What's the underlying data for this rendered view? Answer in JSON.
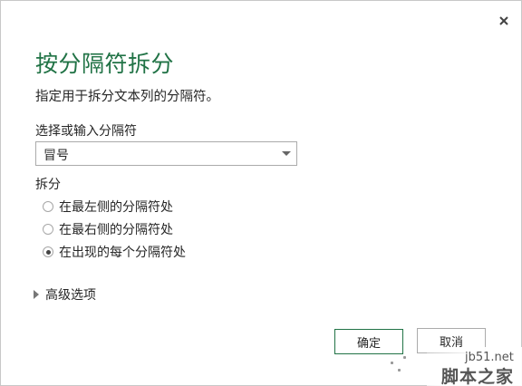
{
  "dialog": {
    "title": "按分隔符拆分",
    "description": "指定用于拆分文本列的分隔符。",
    "close_icon": "close-icon"
  },
  "delimiter": {
    "label": "选择或输入分隔符",
    "selected": "冒号"
  },
  "split": {
    "label": "拆分",
    "options": [
      {
        "label": "在最左侧的分隔符处",
        "checked": false
      },
      {
        "label": "在最右侧的分隔符处",
        "checked": false
      },
      {
        "label": "在出现的每个分隔符处",
        "checked": true
      }
    ]
  },
  "advanced": {
    "label": "高级选项",
    "icon": "triangle-right-icon"
  },
  "buttons": {
    "ok": "确定",
    "cancel": "取消"
  },
  "watermark": {
    "url": "jb51.net",
    "name": "脚本之家"
  },
  "colors": {
    "accent": "#217346"
  }
}
